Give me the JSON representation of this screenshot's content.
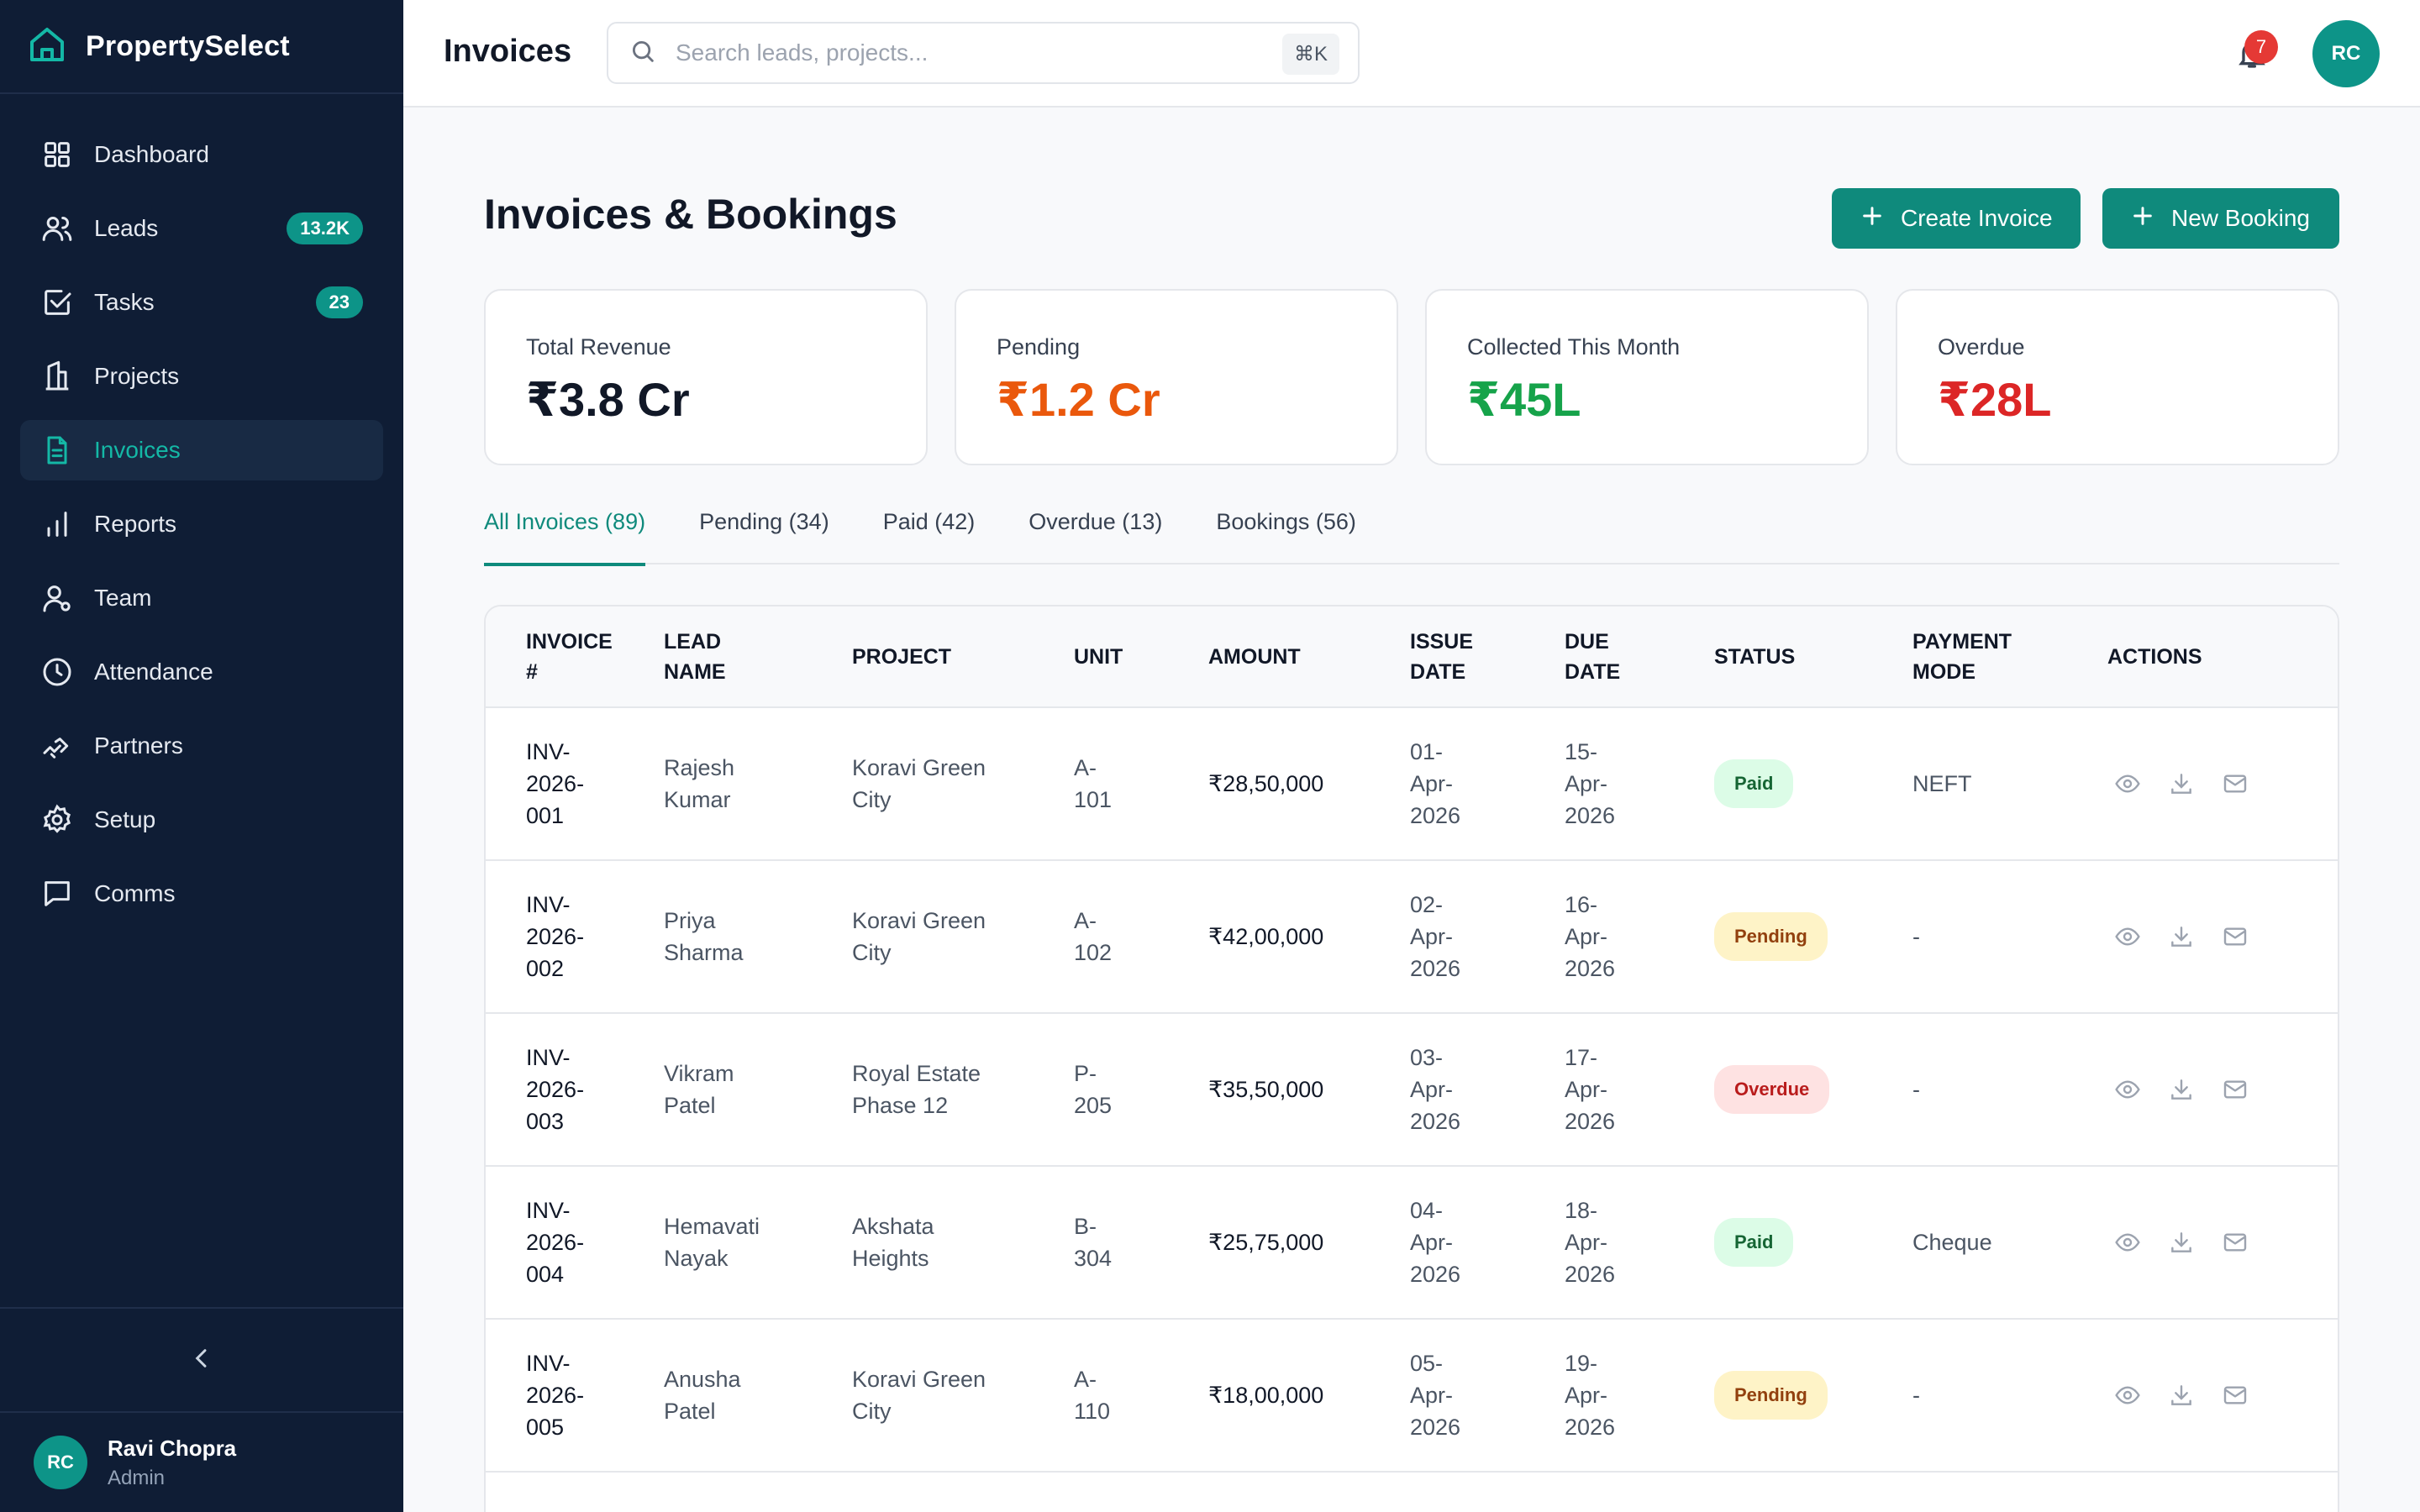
{
  "brand": {
    "name": "PropertySelect"
  },
  "sidebar": {
    "items": [
      {
        "label": "Dashboard",
        "badge": "",
        "icon": "grid-icon"
      },
      {
        "label": "Leads",
        "badge": "13.2K",
        "icon": "users-icon"
      },
      {
        "label": "Tasks",
        "badge": "23",
        "icon": "checkbox-icon"
      },
      {
        "label": "Projects",
        "badge": "",
        "icon": "building-icon"
      },
      {
        "label": "Invoices",
        "badge": "",
        "icon": "document-icon",
        "active": true
      },
      {
        "label": "Reports",
        "badge": "",
        "icon": "bar-chart-icon"
      },
      {
        "label": "Team",
        "badge": "",
        "icon": "user-icon"
      },
      {
        "label": "Attendance",
        "badge": "",
        "icon": "clock-icon"
      },
      {
        "label": "Partners",
        "badge": "",
        "icon": "handshake-icon"
      },
      {
        "label": "Setup",
        "badge": "",
        "icon": "gear-icon"
      },
      {
        "label": "Comms",
        "badge": "",
        "icon": "chat-icon"
      }
    ]
  },
  "user": {
    "initials": "RC",
    "name": "Ravi Chopra",
    "role": "Admin"
  },
  "header": {
    "title": "Invoices",
    "search_placeholder": "Search leads, projects...",
    "shortcut": "⌘K",
    "notification_count": "7",
    "avatar_initials": "RC"
  },
  "main": {
    "title": "Invoices & Bookings",
    "create_invoice_label": "Create Invoice",
    "new_booking_label": "New Booking"
  },
  "stats": [
    {
      "label": "Total Revenue",
      "value": "₹3.8 Cr",
      "color": "#111827"
    },
    {
      "label": "Pending",
      "value": "₹1.2 Cr",
      "color": "#ea580c"
    },
    {
      "label": "Collected This Month",
      "value": "₹45L",
      "color": "#16a34a"
    },
    {
      "label": "Overdue",
      "value": "₹28L",
      "color": "#dc2626"
    }
  ],
  "tabs": [
    {
      "label": "All Invoices (89)",
      "active": true
    },
    {
      "label": "Pending (34)"
    },
    {
      "label": "Paid (42)"
    },
    {
      "label": "Overdue (13)"
    },
    {
      "label": "Bookings (56)"
    }
  ],
  "table": {
    "columns": [
      "Invoice #",
      "Lead Name",
      "Project",
      "Unit",
      "Amount",
      "Issue Date",
      "Due Date",
      "Status",
      "Payment Mode",
      "Actions"
    ],
    "rows": [
      {
        "invoice": "INV-2026-001",
        "lead": "Rajesh Kumar",
        "project": "Koravi Green City",
        "unit": "A-101",
        "amount": "₹28,50,000",
        "issue": "01-Apr-2026",
        "due": "15-Apr-2026",
        "status": "Paid",
        "mode": "NEFT"
      },
      {
        "invoice": "INV-2026-002",
        "lead": "Priya Sharma",
        "project": "Koravi Green City",
        "unit": "A-102",
        "amount": "₹42,00,000",
        "issue": "02-Apr-2026",
        "due": "16-Apr-2026",
        "status": "Pending",
        "mode": "-"
      },
      {
        "invoice": "INV-2026-003",
        "lead": "Vikram Patel",
        "project": "Royal Estate Phase 12",
        "unit": "P-205",
        "amount": "₹35,50,000",
        "issue": "03-Apr-2026",
        "due": "17-Apr-2026",
        "status": "Overdue",
        "mode": "-"
      },
      {
        "invoice": "INV-2026-004",
        "lead": "Hemavati Nayak",
        "project": "Akshata Heights",
        "unit": "B-304",
        "amount": "₹25,75,000",
        "issue": "04-Apr-2026",
        "due": "18-Apr-2026",
        "status": "Paid",
        "mode": "Cheque"
      },
      {
        "invoice": "INV-2026-005",
        "lead": "Anusha Patel",
        "project": "Koravi Green City",
        "unit": "A-110",
        "amount": "₹18,00,000",
        "issue": "05-Apr-2026",
        "due": "19-Apr-2026",
        "status": "Pending",
        "mode": "-"
      }
    ]
  },
  "colors": {
    "sidebar_bg": "#0f1d35",
    "accent": "#0f8a7c",
    "active_text": "#14b8a6"
  }
}
